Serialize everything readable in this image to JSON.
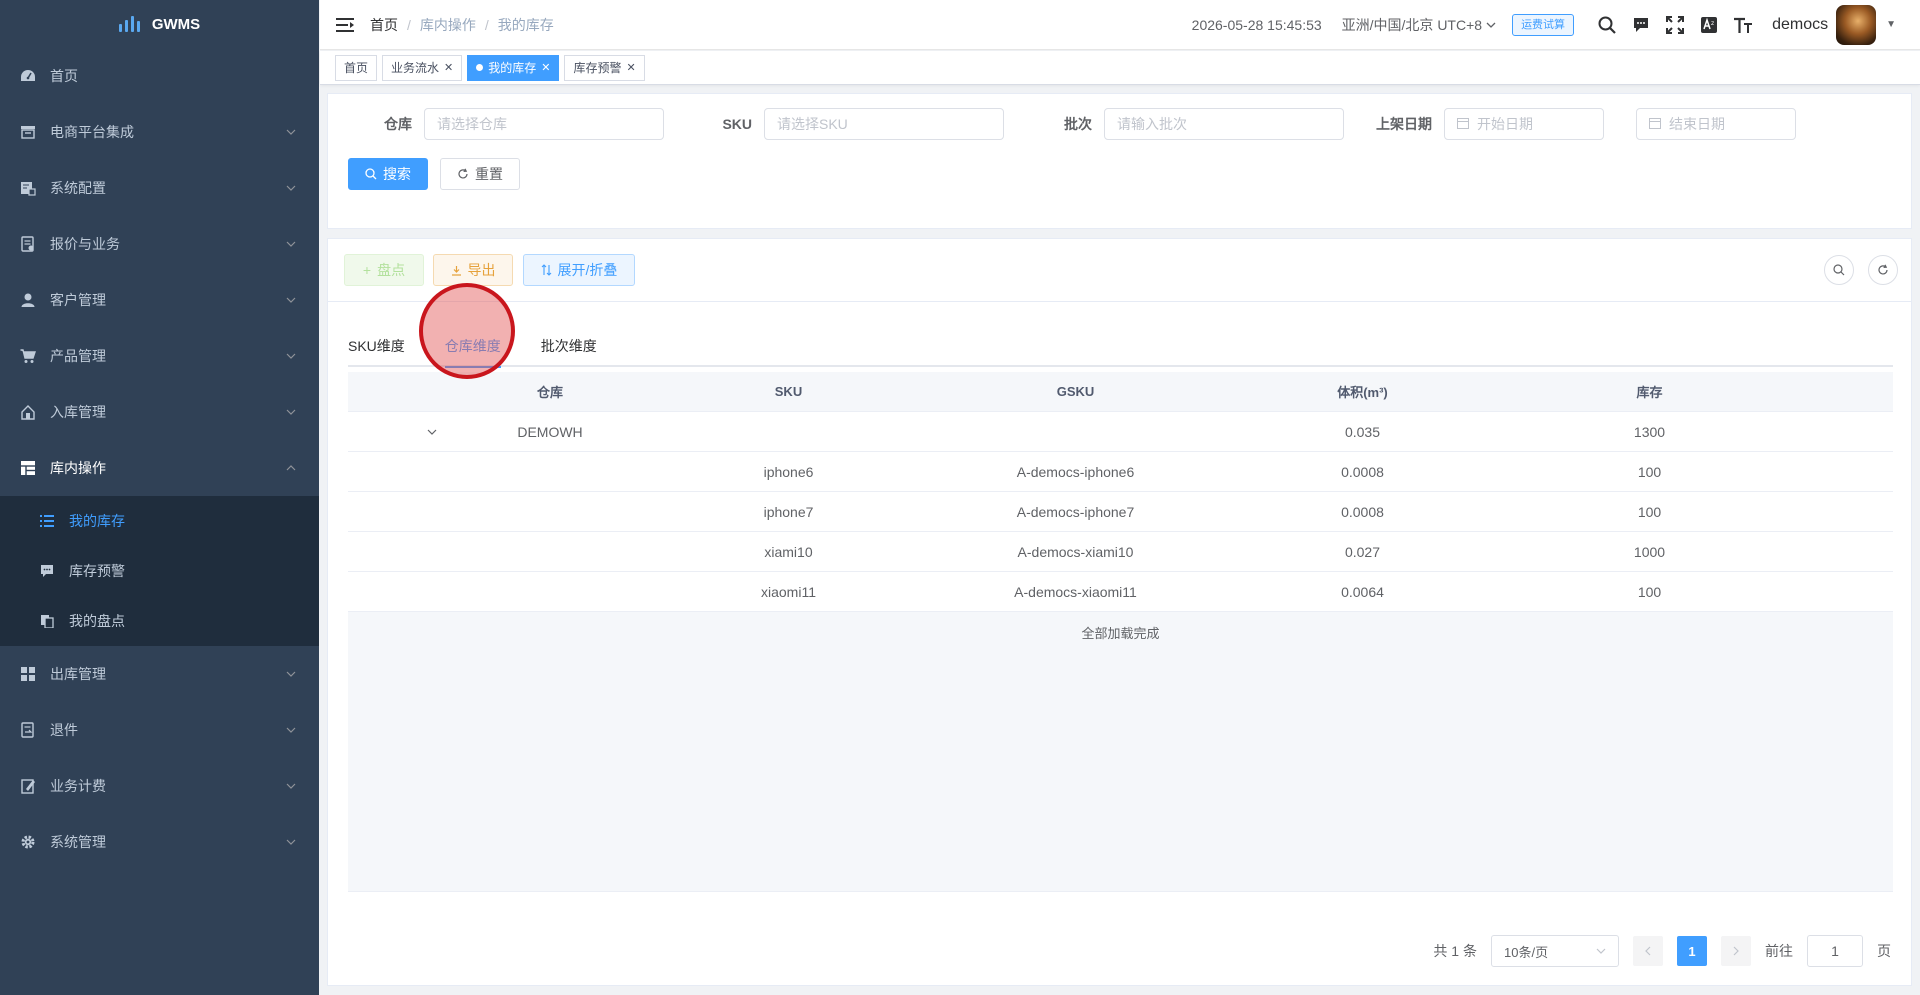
{
  "app": {
    "name": "GWMS"
  },
  "sidebar": {
    "items": [
      {
        "label": "首页",
        "icon": "dashboard-icon"
      },
      {
        "label": "电商平台集成",
        "icon": "store-icon"
      },
      {
        "label": "系统配置",
        "icon": "config-icon"
      },
      {
        "label": "报价与业务",
        "icon": "quote-icon"
      },
      {
        "label": "客户管理",
        "icon": "user-icon"
      },
      {
        "label": "产品管理",
        "icon": "cart-icon"
      },
      {
        "label": "入库管理",
        "icon": "inbound-icon"
      },
      {
        "label": "库内操作",
        "icon": "grid-icon"
      }
    ],
    "submenu": [
      {
        "label": "我的库存",
        "icon": "list-icon"
      },
      {
        "label": "库存预警",
        "icon": "message-icon"
      },
      {
        "label": "我的盘点",
        "icon": "copy-icon"
      }
    ],
    "items_after": [
      {
        "label": "出库管理",
        "icon": "apps-icon"
      },
      {
        "label": "退件",
        "icon": "return-icon"
      },
      {
        "label": "业务计费",
        "icon": "billing-icon"
      },
      {
        "label": "系统管理",
        "icon": "settings-icon"
      }
    ]
  },
  "header": {
    "breadcrumb": [
      "首页",
      "库内操作",
      "我的库存"
    ],
    "datetime": "2026-05-28 15:45:53",
    "timezone": "亚洲/中国/北京 UTC+8",
    "freight_button": "运费试算",
    "username": "democs"
  },
  "tags": [
    {
      "label": "首页",
      "active": false,
      "closable": false
    },
    {
      "label": "业务流水",
      "active": false,
      "closable": true
    },
    {
      "label": "我的库存",
      "active": true,
      "closable": true
    },
    {
      "label": "库存预警",
      "active": false,
      "closable": true
    }
  ],
  "filters": {
    "warehouse": {
      "label": "仓库",
      "placeholder": "请选择仓库"
    },
    "sku": {
      "label": "SKU",
      "placeholder": "请选择SKU"
    },
    "batch": {
      "label": "批次",
      "placeholder": "请输入批次"
    },
    "shelf_date": {
      "label": "上架日期",
      "start_placeholder": "开始日期",
      "end_placeholder": "结束日期"
    },
    "search_button": "搜索",
    "reset_button": "重置"
  },
  "toolbar": {
    "stocktake_button": "盘点",
    "export_button": "导出",
    "expand_button": "展开/折叠"
  },
  "tabs": [
    {
      "label": "SKU维度",
      "active": false
    },
    {
      "label": "仓库维度",
      "active": true
    },
    {
      "label": "批次维度",
      "active": false
    }
  ],
  "table": {
    "columns": [
      "",
      "仓库",
      "SKU",
      "GSKU",
      "体积(m³)",
      "库存"
    ],
    "group_row": {
      "warehouse": "DEMOWH",
      "sku": "",
      "gsku": "",
      "volume": "0.035",
      "stock": "1300"
    },
    "rows": [
      {
        "warehouse": "",
        "sku": "iphone6",
        "gsku": "A-democs-iphone6",
        "volume": "0.0008",
        "stock": "100"
      },
      {
        "warehouse": "",
        "sku": "iphone7",
        "gsku": "A-democs-iphone7",
        "volume": "0.0008",
        "stock": "100"
      },
      {
        "warehouse": "",
        "sku": "xiami10",
        "gsku": "A-democs-xiami10",
        "volume": "0.027",
        "stock": "1000"
      },
      {
        "warehouse": "",
        "sku": "xiaomi11",
        "gsku": "A-democs-xiaomi11",
        "volume": "0.0064",
        "stock": "100"
      }
    ],
    "footer": "全部加载完成"
  },
  "pagination": {
    "total": "共 1 条",
    "page_size": "10条/页",
    "current_page": "1",
    "goto_label": "前往",
    "goto_value": "1",
    "page_suffix": "页"
  },
  "colors": {
    "sidebar_bg": "#304156",
    "primary": "#409eff",
    "active_submenu_bg": "#1f2d3d"
  }
}
